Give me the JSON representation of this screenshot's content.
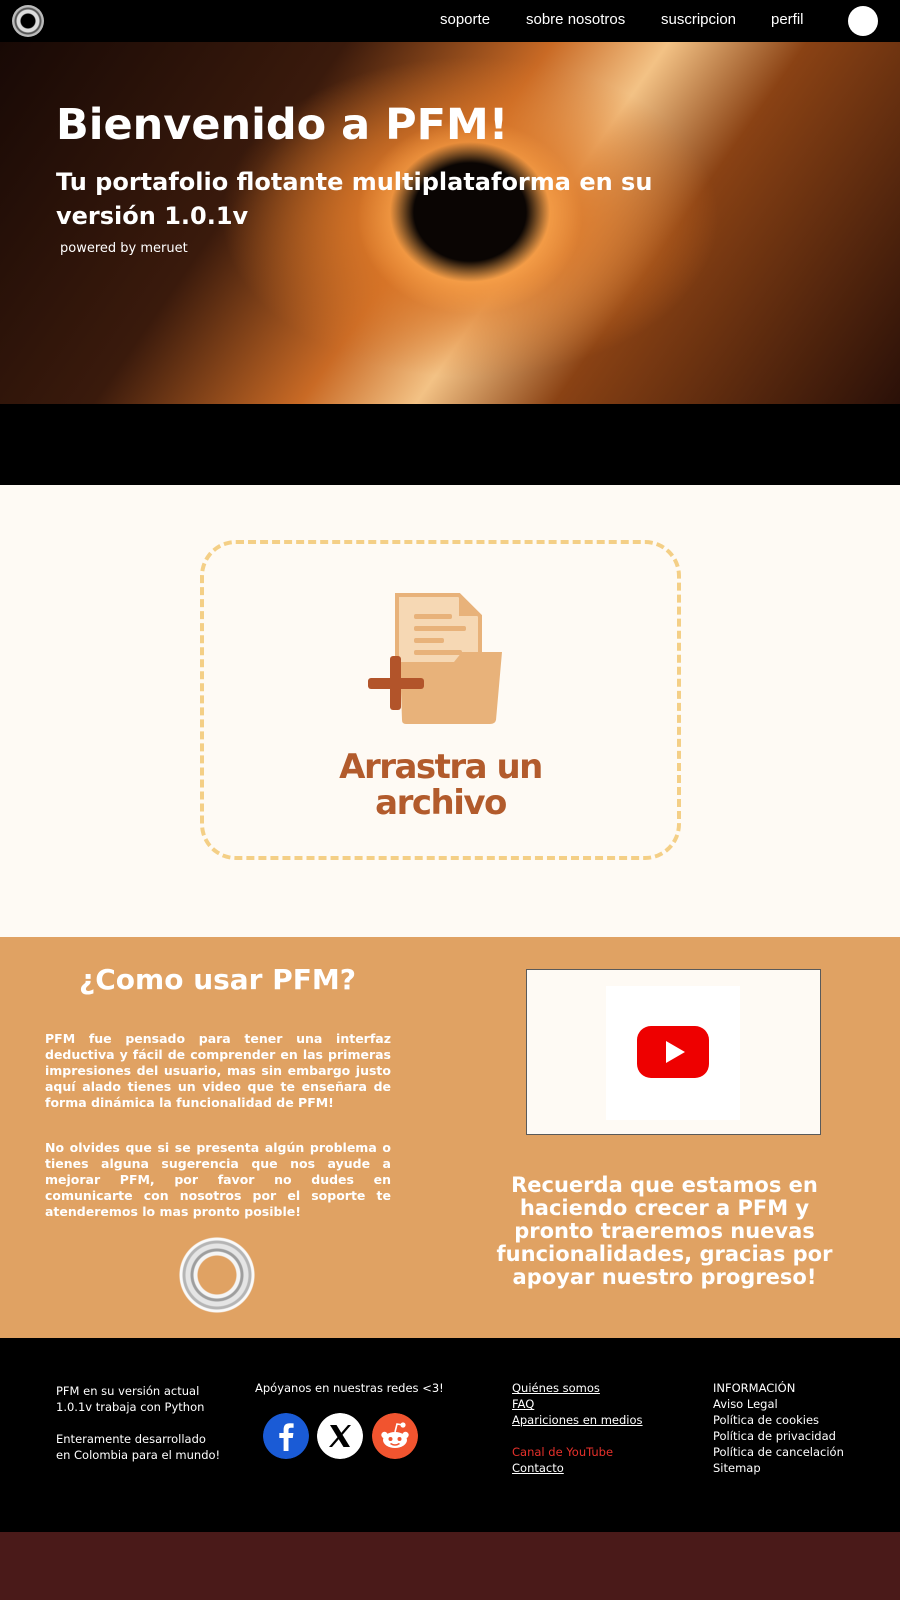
{
  "nav": {
    "links": [
      "soporte",
      "sobre nosotros",
      "suscripcion",
      "perfil"
    ]
  },
  "hero": {
    "title": "Bienvenido a PFM!",
    "subtitle": "Tu portafolio flotante multiplataforma en su versión 1.0.1v",
    "powered": "powered by meruet"
  },
  "upload": {
    "label_line1": "Arrastra un",
    "label_line2": "archivo"
  },
  "howto": {
    "title": "¿Como usar PFM?",
    "paragraph1": "PFM fue pensado para tener una interfaz deductiva y fácil de comprender en las primeras impresiones del usuario, mas sin embargo justo aquí alado tienes un video que te enseñara de forma dinámica la funcionalidad de PFM!",
    "paragraph2": "No olvides que si se presenta algún problema o tienes alguna sugerencia que nos ayude a mejorar PFM, por favor no dudes en comunicarte con nosotros por el soporte te atenderemos lo mas pronto posible!",
    "remember": "Recuerda que estamos en haciendo crecer a PFM y pronto traeremos nuevas funcionalidades, gracias por apoyar nuestro progreso!"
  },
  "footer": {
    "about_line1": "PFM en su versión actual",
    "about_line2": "1.0.1v trabaja con Python",
    "about_line3": "Enteramente desarrollado",
    "about_line4": "en Colombia para el mundo!",
    "social_label": "Apóyanos en nuestras redes <3!",
    "social": [
      "facebook",
      "x",
      "reddit"
    ],
    "links": {
      "about": "Quiénes somos",
      "faq": "FAQ",
      "media": "Apariciones en medios",
      "youtube": "Canal de YouTube",
      "contact": "Contacto"
    },
    "info": {
      "heading": "INFORMACIÓN",
      "items": [
        "Aviso Legal",
        "Política de cookies",
        "Política de privacidad",
        "Política de cancelación",
        "Sitemap"
      ]
    }
  },
  "colors": {
    "accent": "#e0a263",
    "dropzone_border": "#f4cf86",
    "label_brown": "#b25b2c",
    "youtube_red": "#ee0000",
    "footer_bottom": "#4a1a19"
  }
}
